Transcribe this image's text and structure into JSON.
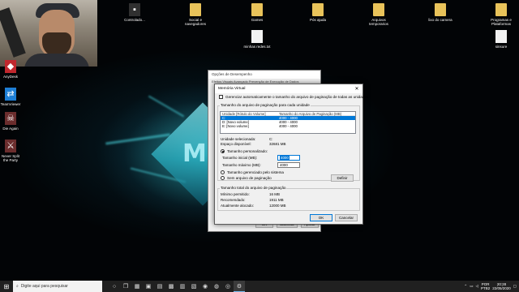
{
  "desktop": {
    "icons_top": [
      {
        "label": "Controlado...",
        "icon": "file-icon"
      },
      {
        "label": "Social e navegadores",
        "icon": "folder-icon"
      },
      {
        "label": "Games",
        "icon": "folder-icon"
      },
      {
        "label": "Pós ajuda",
        "icon": "folder-icon"
      },
      {
        "label": "Arquivos temporarios",
        "icon": "folder-icon"
      },
      {
        "label": "lixo do camera",
        "icon": "folder-icon"
      },
      {
        "label": "Programas e Plataformas",
        "icon": "folder-icon"
      }
    ],
    "icon_notes": {
      "label": "minhas redes.txt",
      "icon": "text-file-icon"
    },
    "icon_unsure": {
      "label": "sinsure",
      "icon": "file-icon"
    },
    "icons_left": [
      {
        "label": "AnyDesk",
        "icon": "anydesk-icon"
      },
      {
        "label": "TeamViewer",
        "icon": "teamviewer-icon"
      },
      {
        "label": "Die Again",
        "icon": "game-icon"
      },
      {
        "label": "Never Split the Party",
        "icon": "game-icon"
      }
    ]
  },
  "perf_window": {
    "title": "Opções de Desempenho",
    "tabs_text": "Efeitos Visuais   Avançado   Prevenção de Execução de Dados",
    "ok": "OK",
    "cancel": "Cancelar",
    "apply": "Aplicar"
  },
  "vm_dialog": {
    "title": "Memória Virtual",
    "close": "✕",
    "auto_manage": "Gerenciar automaticamente o tamanho do arquivo de paginação de todas as unidades",
    "group_per_drive": "Tamanho do arquivo de paginação para cada unidade",
    "col_drive": "Unidade [Rótulo do Volume]",
    "col_size": "Tamanho do Arquivo de Paginação (MB)",
    "drives": [
      {
        "drive": "C:",
        "size": "4000 - 4000",
        "selected": true
      },
      {
        "drive": "D:     [Novo volume]",
        "size": "4000 - 4000",
        "selected": false
      },
      {
        "drive": "E:     [Novo volume]",
        "size": "4000 - 4000",
        "selected": false
      }
    ],
    "selected_drive_label": "Unidade selecionada:",
    "selected_drive_value": "C:",
    "free_space_label": "Espaço disponível:",
    "free_space_value": "32681 MB",
    "custom_size": "Tamanho personalizado:",
    "initial_label": "Tamanho inicial (MB):",
    "initial_value": "4000",
    "max_label": "Tamanho máximo (MB):",
    "max_value": "4000",
    "system_managed": "Tamanho gerenciado pelo sistema",
    "no_paging": "Sem arquivo de paginação",
    "set_button": "Definir",
    "group_total": "Tamanho total do arquivo de paginação",
    "min_allowed_label": "Mínimo permitido:",
    "min_allowed_value": "16 MB",
    "recommended_label": "Recomendado:",
    "recommended_value": "1911 MB",
    "current_label": "Atualmente alocado:",
    "current_value": "12000 MB",
    "ok": "OK",
    "cancel": "Cancelar"
  },
  "taskbar": {
    "search_placeholder": "Digite aqui para pesquisar",
    "lang": "POR",
    "lang2": "PTB2",
    "time": "20:28",
    "date": "22/05/2020"
  }
}
